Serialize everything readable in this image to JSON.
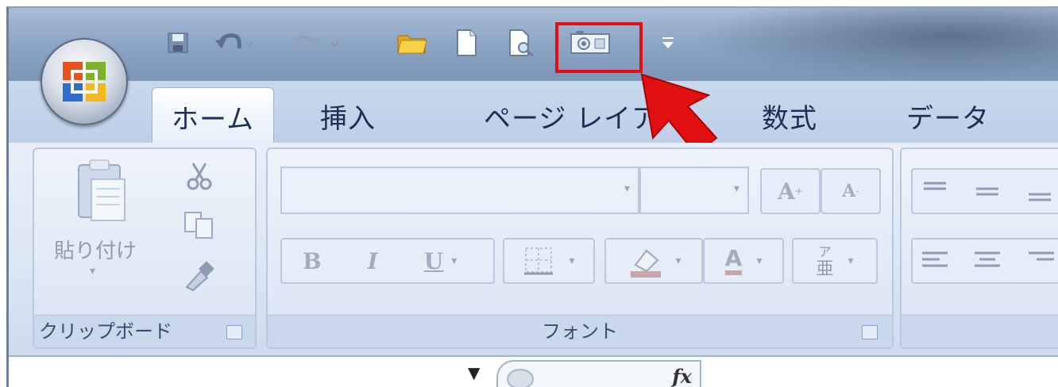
{
  "tabs": [
    {
      "label": "ホーム",
      "active": true
    },
    {
      "label": "挿入",
      "active": false
    },
    {
      "label": "ページ レイア",
      "active": false
    },
    {
      "label": "数式",
      "active": false
    },
    {
      "label": "データ",
      "active": false
    }
  ],
  "groups": {
    "clipboard": {
      "paste_label": "貼り付け",
      "label": "クリップボード"
    },
    "font": {
      "label": "フォント",
      "bold": "B",
      "italic": "I",
      "underline": "U",
      "grow": "A",
      "shrink": "A",
      "phonetic_top": "ア",
      "phonetic_bottom": "亜"
    }
  },
  "formula_bar": {
    "fx": "fx"
  },
  "quick_access": {
    "items": [
      "save-icon",
      "undo-icon",
      "redo-icon",
      "open-folder-icon",
      "new-document-icon",
      "print-preview-icon",
      "camera-icon",
      "customize-qat-icon"
    ],
    "highlighted": "camera-icon"
  },
  "colors": {
    "highlight": "#e01010",
    "arrow": "#e01010"
  }
}
